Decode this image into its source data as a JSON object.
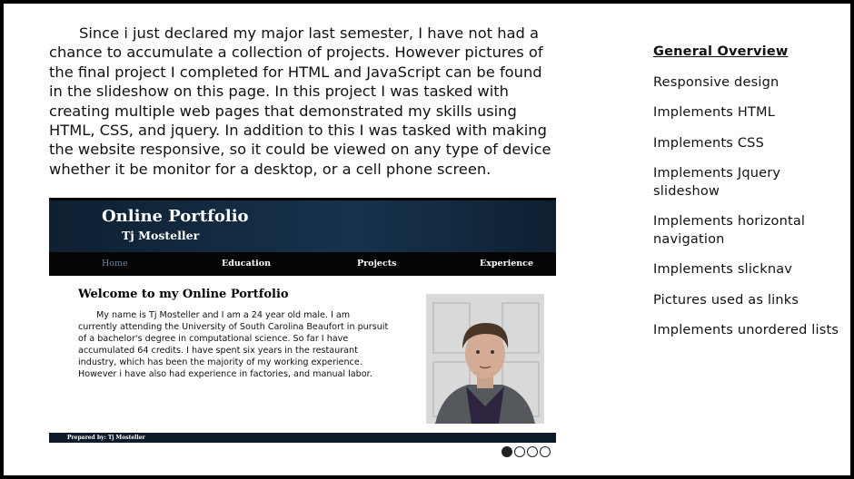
{
  "intro_text": "Since i just declared my major last semester, I have not had a chance to accumulate a collection of projects. However pictures of the final project I completed for HTML and JavaScript can be found in the slideshow on this page. In this project I was tasked with creating multiple web pages that demonstrated my skills using HTML, CSS, and jquery. In addition to this I was tasked with making the website responsive, so it could be viewed on any type of device whether it be monitor for a desktop, or a cell phone screen.",
  "slide": {
    "title": "Online Portfolio",
    "subtitle": "Tj Mosteller",
    "nav": [
      "Home",
      "Education",
      "Projects",
      "Experience"
    ],
    "active_nav": "Home",
    "welcome": "Welcome to my Online Portfolio",
    "bio": "My name is Tj Mosteller and I am a 24 year old male. I am currently attending the University of South Carolina Beaufort in pursuit of a bachelor's degree in computational science. So far I have accumulated 64 credits. I have spent six years in the restaurant industry, which has been the majority of my working experience. However i have also had experience in factories, and manual labor.",
    "footer": "Prepared by: Tj Mosteller"
  },
  "slideshow": {
    "slide_count": 4,
    "active_index": 1
  },
  "sidebar": {
    "items": [
      "General Overview",
      "Responsive design",
      "Implements HTML",
      "Implements CSS",
      "Implements Jquery slideshow",
      "Implements horizontal navigation",
      "Implements slicknav",
      "Pictures used as links",
      "Implements unordered lists"
    ],
    "active_index": 0
  },
  "colors": {
    "header_bg": "#16324c",
    "nav_bg": "#050505",
    "active_nav": "#6b86a8"
  }
}
